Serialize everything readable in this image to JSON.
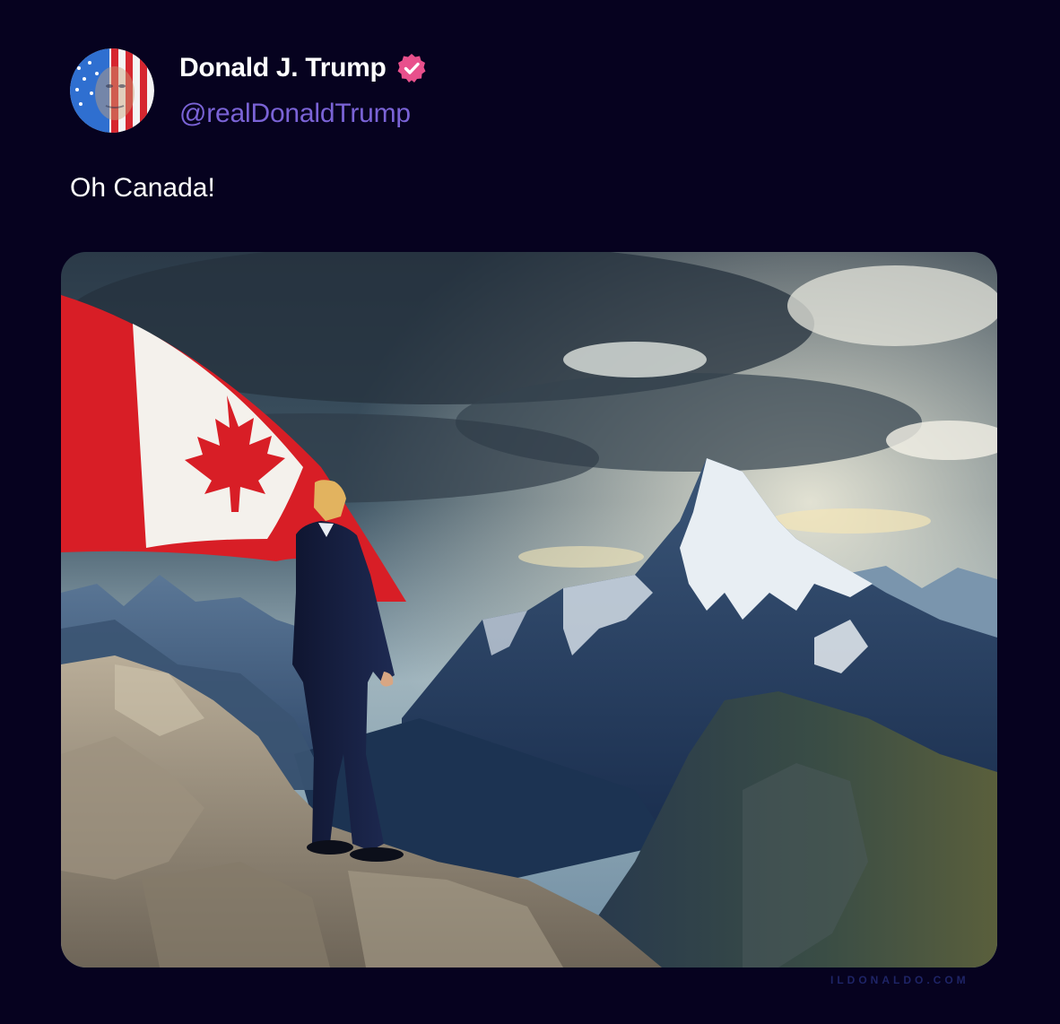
{
  "post": {
    "display_name": "Donald J. Trump",
    "handle": "@realDonaldTrump",
    "text": "Oh Canada!",
    "verified_icon": "verified-badge-icon"
  },
  "media": {
    "icon": "photo-canada-flag-mountain"
  },
  "watermark": "ILDONALDO.COM",
  "colors": {
    "background": "#06021f",
    "name": "#ffffff",
    "handle": "#7a63d6",
    "verified_badge": "#e8508c",
    "watermark": "#1e2466"
  }
}
